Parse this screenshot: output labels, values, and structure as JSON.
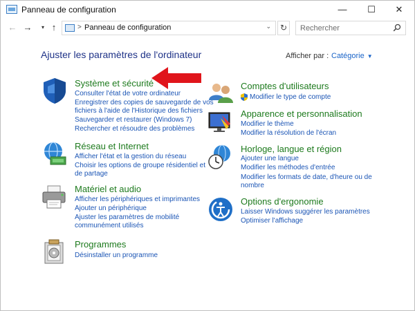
{
  "window": {
    "title": "Panneau de configuration",
    "controls": {
      "minimize": "—",
      "maximize": "☐",
      "close": "✕"
    }
  },
  "nav": {
    "back": "←",
    "forward": "→",
    "recent": "▾",
    "up": "↑",
    "separator": ">",
    "address": "Panneau de configuration",
    "dropdown": "⌄",
    "refresh": "↻",
    "search_placeholder": "Rechercher"
  },
  "page": {
    "title": "Ajuster les paramètres de l'ordinateur",
    "view_by_label": "Afficher par :",
    "view_by_value": "Catégorie",
    "view_by_caret": "▼"
  },
  "categories": [
    {
      "icon": "shield-icon",
      "heading": "Système et sécurité",
      "links": [
        "Consulter l'état de votre ordinateur",
        "Enregistrer des copies de sauvegarde de vos",
        "fichiers à l'aide de l'Historique des fichiers",
        "Sauvegarder et restaurer (Windows 7)",
        "Rechercher et résoudre des problèmes"
      ]
    },
    {
      "icon": "network-globe-icon",
      "heading": "Réseau et Internet",
      "links": [
        "Afficher l'état et la gestion du réseau",
        "Choisir les options de groupe résidentiel et",
        "de partage"
      ]
    },
    {
      "icon": "printer-icon",
      "heading": "Matériel et audio",
      "links": [
        "Afficher les périphériques et imprimantes",
        "Ajouter un périphérique",
        "Ajuster les paramètres de mobilité",
        "communément utilisés"
      ]
    },
    {
      "icon": "programs-icon",
      "heading": "Programmes",
      "links": [
        "Désinstaller un programme"
      ]
    },
    {
      "icon": "users-icon",
      "heading": "Comptes d'utilisateurs",
      "links": [
        "Modifier le type de compte"
      ]
    },
    {
      "icon": "appearance-icon",
      "heading": "Apparence et personnalisation",
      "links": [
        "Modifier le thème",
        "Modifier la résolution de l'écran"
      ]
    },
    {
      "icon": "clock-globe-icon",
      "heading": "Horloge, langue et région",
      "links": [
        "Ajouter une langue",
        "Modifier les méthodes d'entrée",
        "Modifier les formats de date, d'heure ou de",
        "nombre"
      ]
    },
    {
      "icon": "ease-of-access-icon",
      "heading": "Options d'ergonomie",
      "links": [
        "Laisser Windows suggérer les paramètres",
        "Optimiser l'affichage"
      ]
    }
  ],
  "colors": {
    "heading_green": "#1d7a1d",
    "link_blue": "#1b55b5",
    "title_blue": "#1e3287",
    "annotation_red": "#e0151b"
  }
}
